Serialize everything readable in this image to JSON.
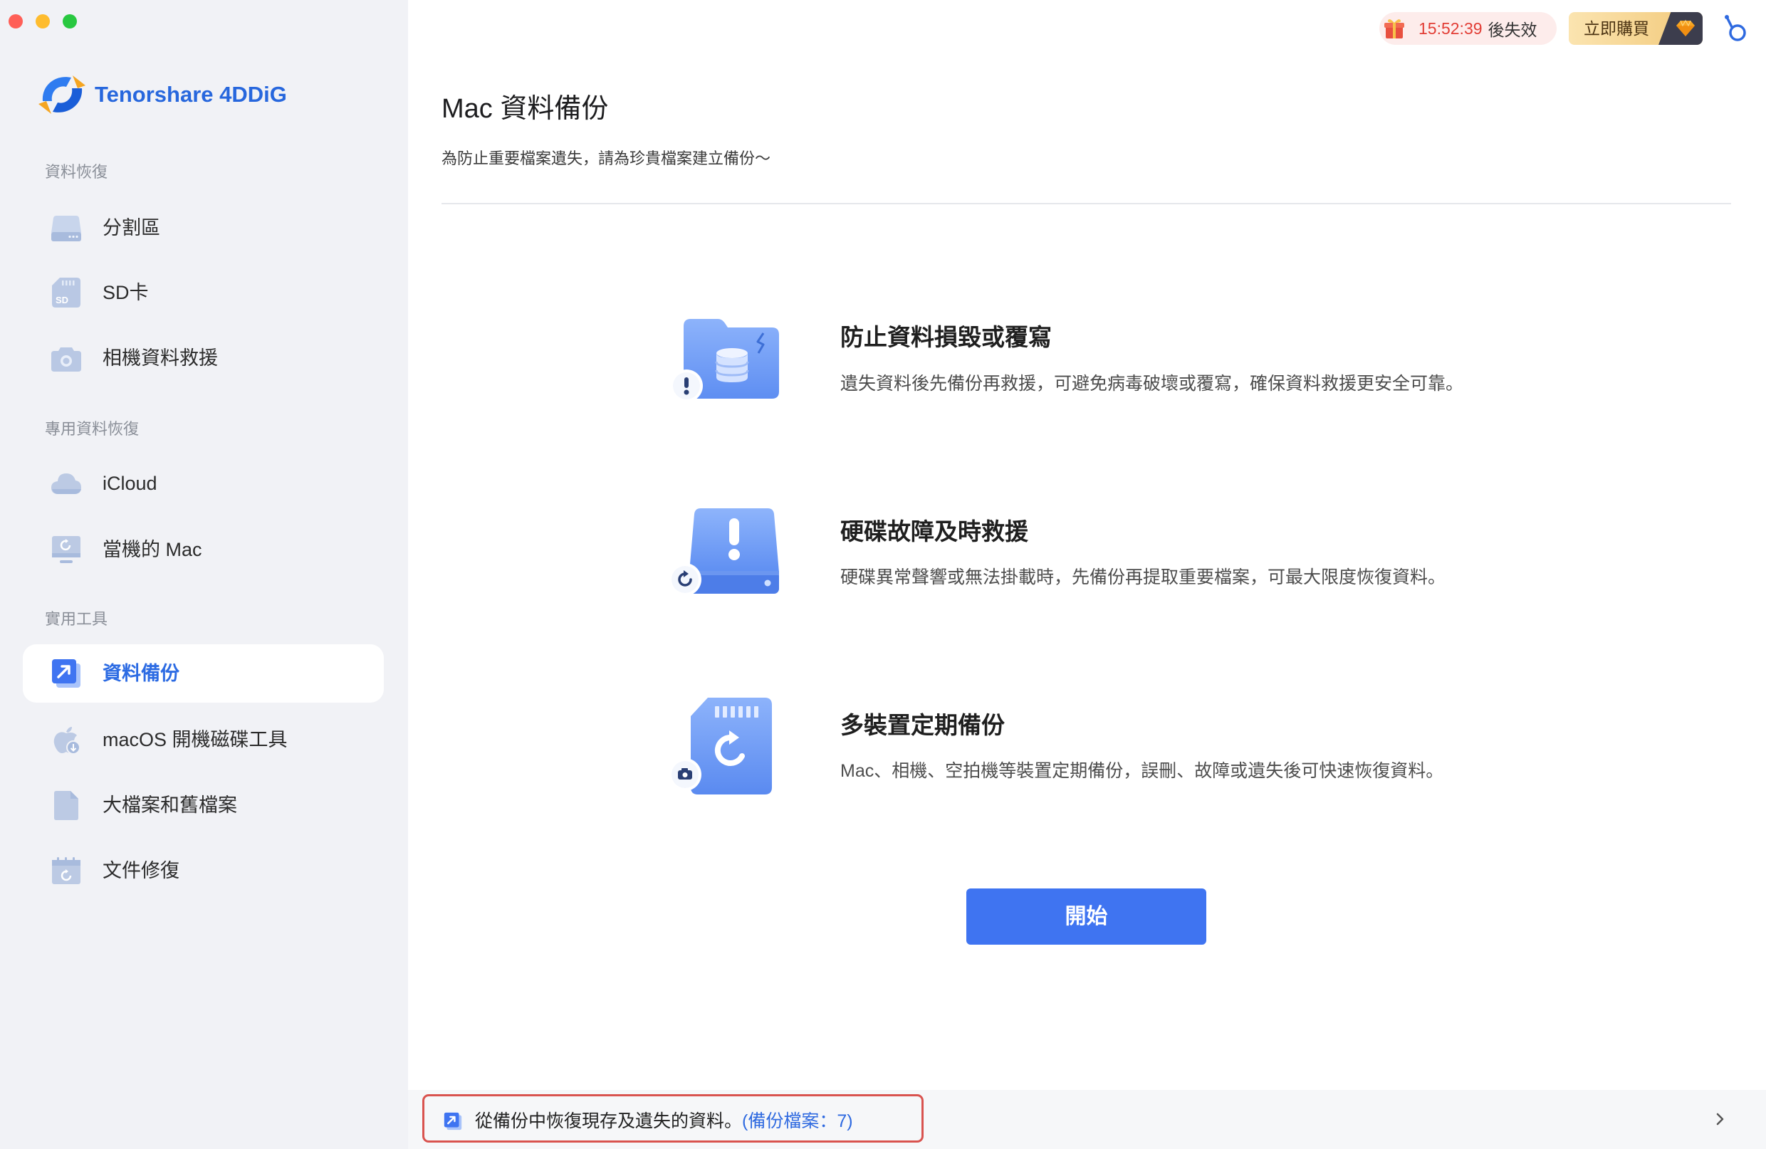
{
  "window": {
    "controls": [
      "close",
      "minimize",
      "zoom"
    ]
  },
  "brand": {
    "name": "Tenorshare 4DDiG",
    "logo_icon": "4ddig-logo-icon"
  },
  "sidebar": {
    "sections": [
      {
        "label": "資料恢復",
        "items": [
          {
            "label": "分割區",
            "icon": "drive-icon",
            "selected": false
          },
          {
            "label": "SD卡",
            "icon": "sd-card-icon",
            "icon_text": "SD",
            "selected": false
          },
          {
            "label": "相機資料救援",
            "icon": "camera-icon",
            "selected": false
          }
        ]
      },
      {
        "label": "專用資料恢復",
        "items": [
          {
            "label": "iCloud",
            "icon": "cloud-icon",
            "selected": false
          },
          {
            "label": "當機的 Mac",
            "icon": "crashed-mac-icon",
            "selected": false
          }
        ]
      },
      {
        "label": "實用工具",
        "items": [
          {
            "label": "資料備份",
            "icon": "backup-icon",
            "selected": true
          },
          {
            "label": "macOS 開機磁碟工具",
            "icon": "apple-disk-icon",
            "selected": false
          },
          {
            "label": "大檔案和舊檔案",
            "icon": "file-icon",
            "selected": false
          },
          {
            "label": "文件修復",
            "icon": "document-repair-icon",
            "selected": false
          }
        ]
      }
    ]
  },
  "topbar": {
    "promo": {
      "countdown": "15:52:39",
      "suffix": "後失效",
      "icon": "gift-icon"
    },
    "buy_label": "立即購買",
    "buy_icon": "diamond-icon",
    "account_icon": "account-icon"
  },
  "main": {
    "title": "Mac 資料備份",
    "subtitle": "為防止重要檔案遺失，請為珍貴檔案建立備份～",
    "features": [
      {
        "title": "防止資料損毀或覆寫",
        "description": "遺失資料後先備份再救援，可避免病毒破壞或覆寫，確保資料救援更安全可靠。",
        "icon": "folder-database-icon"
      },
      {
        "title": "硬碟故障及時救援",
        "description": "硬碟異常聲響或無法掛載時，先備份再提取重要檔案，可最大限度恢復資料。",
        "icon": "hard-drive-alert-icon"
      },
      {
        "title": "多裝置定期備份",
        "description": "Mac、相機、空拍機等裝置定期備份，誤刪、故障或遺失後可快速恢復資料。",
        "icon": "sd-card-restore-icon"
      }
    ],
    "start_label": "開始"
  },
  "footer": {
    "text": "從備份中恢復現存及遺失的資料。",
    "backup_count_label": "(備份檔案：7)",
    "icon": "backup-restore-icon",
    "chevron": "chevron-right-icon"
  },
  "colors": {
    "accent": "#3f74f1",
    "brand": "#2767dd",
    "sidebar_bg": "#f1f2f6",
    "countdown": "#e23d35",
    "highlight_border": "#d9534f"
  }
}
